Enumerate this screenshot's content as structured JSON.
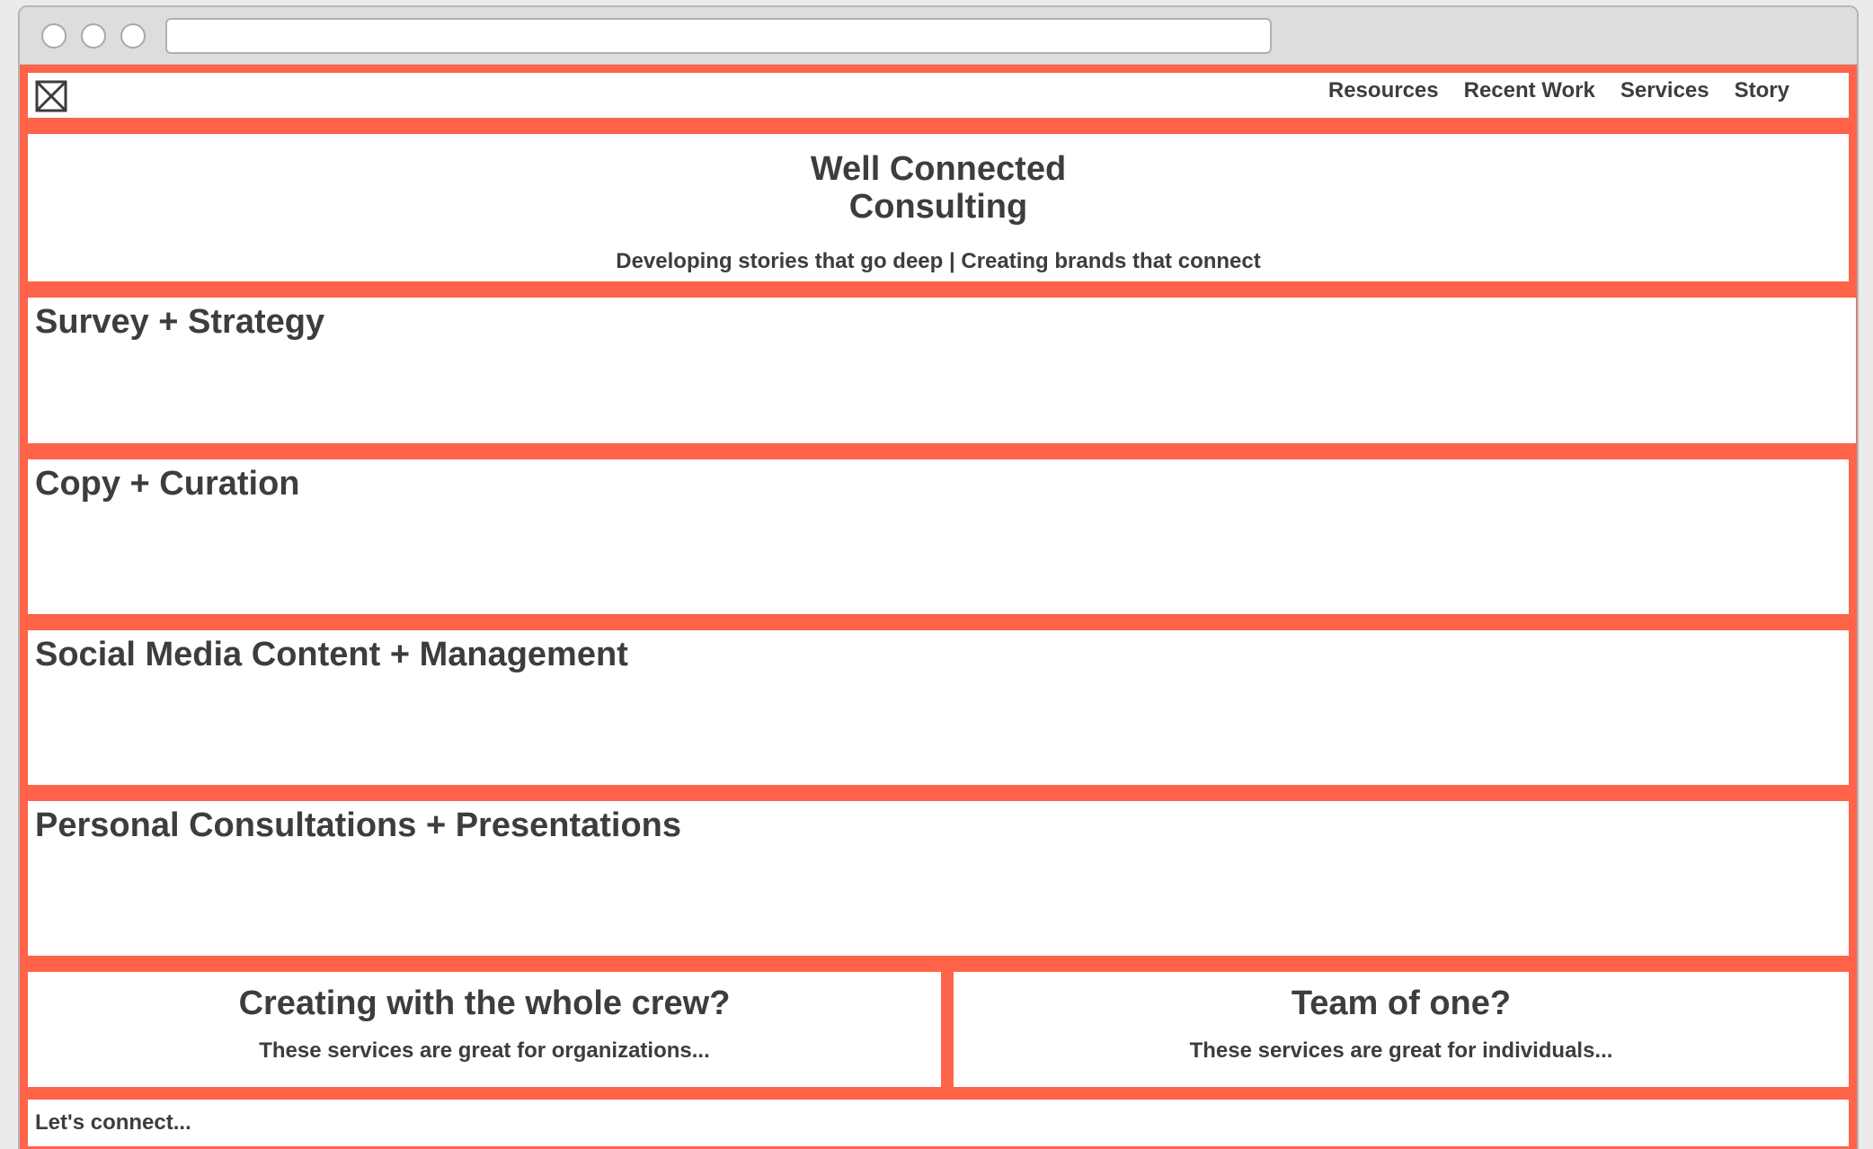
{
  "nav": {
    "links": [
      "Resources",
      "Recent Work",
      "Services",
      "Story"
    ]
  },
  "hero": {
    "title_line1": "Well Connected",
    "title_line2": "Consulting",
    "subtitle": "Developing stories that go deep | Creating brands that connect"
  },
  "sections": [
    {
      "title": "Survey + Strategy"
    },
    {
      "title": "Copy + Curation"
    },
    {
      "title": "Social Media Content + Management"
    },
    {
      "title": "Personal Consultations + Presentations"
    }
  ],
  "audiences": {
    "organizations": {
      "title": "Creating with the whole crew?",
      "text": "These services are great for organizations..."
    },
    "individuals": {
      "title": "Team of one?",
      "text": "These services are great for individuals..."
    }
  },
  "footer": {
    "text": "Let's connect..."
  },
  "colors": {
    "accent_border": "#ff634a",
    "text": "#3d3d3d",
    "chrome": "#dddddd"
  }
}
